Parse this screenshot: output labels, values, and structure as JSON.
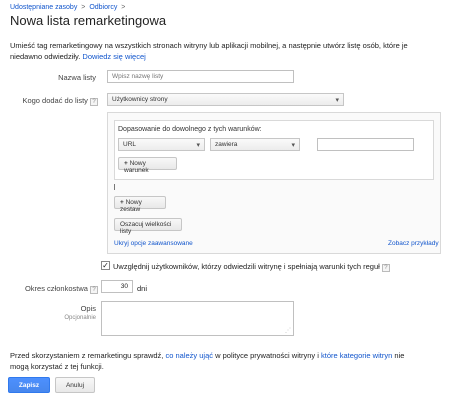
{
  "breadcrumb": {
    "item1": "Udostępniane zasoby",
    "item2": "Odbiorcy",
    "sep": ">"
  },
  "page_title": "Nowa lista remarketingowa",
  "intro": {
    "text": "Umieść tag remarketingowy na wszystkich stronach witryny lub aplikacji mobilnej, a następnie utwórz listę osób, które je niedawno odwiedziły.",
    "link": "Dowiedz się więcej"
  },
  "list_name": {
    "label": "Nazwa listy",
    "placeholder": "Wpisz nazwę listy"
  },
  "who_to_add": {
    "label": "Kogo dodać do listy",
    "help": "?",
    "selected": "Użytkownicy strony"
  },
  "rules": {
    "group_label": "Dopasowanie do dowolnego z tych warunków:",
    "field_selected": "URL",
    "operator_selected": "zawiera",
    "value": "",
    "new_condition": "Nowy warunek",
    "new_set": "Nowy zestaw",
    "estimate_button": "Oszacuj wielkości listy",
    "hide_advanced": "Ukryj opcje zaawansowane",
    "see_examples": "Zobacz przykłady"
  },
  "include_past": {
    "checked": true,
    "label": "Uwzględnij użytkowników, którzy odwiedzili witrynę i spełniają warunki tych reguł",
    "help": "?"
  },
  "membership": {
    "label": "Okres członkostwa",
    "help": "?",
    "value": "30",
    "unit": "dni"
  },
  "description": {
    "label": "Opis",
    "sublabel": "Opcjonalnie",
    "value": ""
  },
  "policy": {
    "text1": "Przed skorzystaniem z remarketingu sprawdź,",
    "link1": "co należy ująć",
    "text2": "w polityce prywatności witryny i",
    "link2": "które kategorie witryn",
    "text3": "nie mogą korzystać z tej funkcji."
  },
  "buttons": {
    "save": "Zapisz",
    "cancel": "Anuluj"
  },
  "icons": {
    "dropdown": "▾",
    "plus": "+"
  }
}
